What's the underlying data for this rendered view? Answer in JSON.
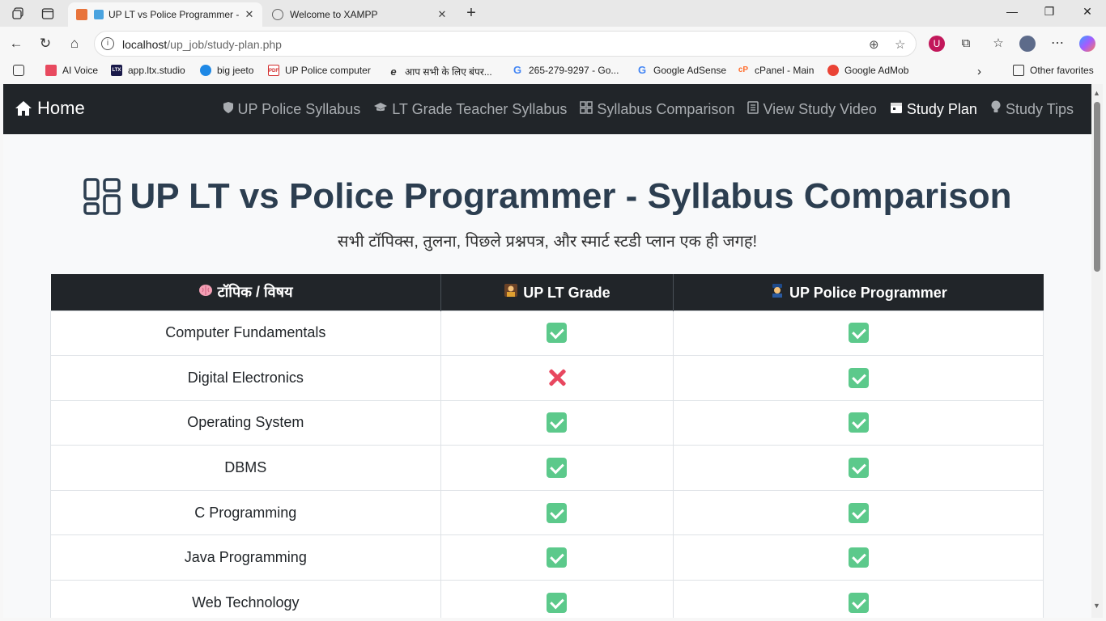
{
  "browser": {
    "tabs": [
      {
        "title": "UP LT vs Police Programmer -",
        "active": true
      },
      {
        "title": "Welcome to XAMPP",
        "active": false
      }
    ],
    "url": {
      "host": "localhost",
      "path": "/up_job/study-plan.php"
    },
    "bookmarks": [
      {
        "label": "AI Voice",
        "color": "#e84a5f"
      },
      {
        "label": "app.ltx.studio",
        "color": "#1a1a4a"
      },
      {
        "label": "big jeeto",
        "color": "#1e88e5"
      },
      {
        "label": "UP Police computer",
        "color": "#d32f2f"
      },
      {
        "label": "आप सभी के लिए बंपर...",
        "color": "#555555"
      },
      {
        "label": "265-279-9297 - Go...",
        "color": "#4285f4"
      },
      {
        "label": "Google AdSense",
        "color": "#4285f4"
      },
      {
        "label": "cPanel - Main",
        "color": "#ff6c2c"
      },
      {
        "label": "Google AdMob",
        "color": "#ea4335"
      }
    ],
    "other_favorites": "Other favorites"
  },
  "navbar": {
    "brand": "Home",
    "links": [
      {
        "label": "UP Police Syllabus",
        "icon": "shield-icon",
        "active": false
      },
      {
        "label": "LT Grade Teacher Syllabus",
        "icon": "graduation-cap-icon",
        "active": false
      },
      {
        "label": "Syllabus Comparison",
        "icon": "grid-icon",
        "active": false
      },
      {
        "label": "View Study Video",
        "icon": "journal-icon",
        "active": false
      },
      {
        "label": "Study Plan",
        "icon": "calendar-icon",
        "active": true
      },
      {
        "label": "Study Tips",
        "icon": "lightbulb-icon",
        "active": false
      }
    ]
  },
  "hero": {
    "title": "UP LT vs Police Programmer - Syllabus Comparison",
    "subtitle": "सभी टॉपिक्स, तुलना, पिछले प्रश्नपत्र, और स्मार्ट स्टडी प्लान एक ही जगह!"
  },
  "table": {
    "headers": [
      "टॉपिक / विषय",
      "UP LT Grade",
      "UP Police Programmer"
    ],
    "header_icons": [
      "brain-icon",
      "teacher-icon",
      "police-officer-icon"
    ],
    "rows": [
      {
        "topic": "Computer Fundamentals",
        "lt": true,
        "police": true
      },
      {
        "topic": "Digital Electronics",
        "lt": false,
        "police": true
      },
      {
        "topic": "Operating System",
        "lt": true,
        "police": true
      },
      {
        "topic": "DBMS",
        "lt": true,
        "police": true
      },
      {
        "topic": "C Programming",
        "lt": true,
        "police": true
      },
      {
        "topic": "Java Programming",
        "lt": true,
        "police": true
      },
      {
        "topic": "Web Technology",
        "lt": true,
        "police": true
      }
    ]
  },
  "colors": {
    "navbar_bg": "#212529",
    "title": "#2c3e50",
    "yes": "#5cc98b",
    "no": "#e8475f"
  }
}
